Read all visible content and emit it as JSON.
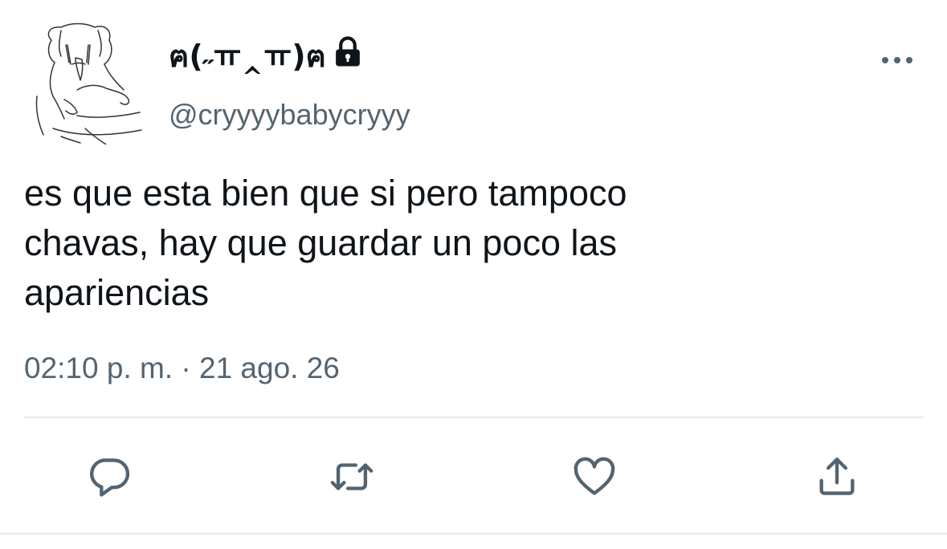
{
  "tweet": {
    "display_name": "ฅ(˶ㅠ‸ㅠ)ฅ",
    "handle": "@cryyyybabycryyy",
    "text_lines": [
      "es que esta bien que si pero tampoco",
      "chavas, hay que guardar un poco las",
      "apariencias"
    ],
    "timestamp": "02:10 p. m. · 21 ago. 26",
    "protected_icon": "lock-icon",
    "more_icon": "more-options-icon"
  },
  "actions": [
    {
      "name": "reply",
      "icon": "reply-icon"
    },
    {
      "name": "retweet",
      "icon": "retweet-icon"
    },
    {
      "name": "like",
      "icon": "heart-icon"
    },
    {
      "name": "share",
      "icon": "share-icon"
    }
  ],
  "colors": {
    "text_primary": "#0f1419",
    "text_secondary": "#536471",
    "divider": "#e8ebed"
  }
}
